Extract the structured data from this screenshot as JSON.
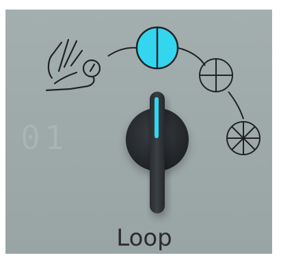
{
  "display": {
    "index_value": "01",
    "knob_label": "Loop"
  },
  "icons": {
    "manual": "hand-dial-icon",
    "mode_2": "circle-halved-icon",
    "mode_4": "circle-quartered-icon",
    "mode_8": "circle-eighths-icon"
  },
  "state": {
    "selected_mode": "circle-halved"
  },
  "colors": {
    "panel": "#9ea9a9",
    "accent": "#33d6ee",
    "outline": "#1f2225",
    "knob": "#2a2d30",
    "index_text": "#a9b4b4"
  }
}
